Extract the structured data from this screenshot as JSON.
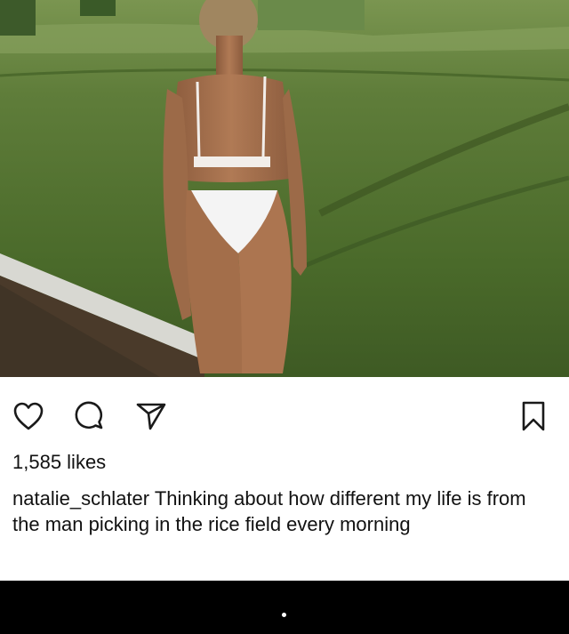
{
  "post": {
    "likes_text": "1,585 likes",
    "username": "natalie_schlater",
    "caption": "Thinking about how different my life is from the man picking in the rice field every morning"
  },
  "icons": {
    "like": "heart-icon",
    "comment": "comment-icon",
    "share": "send-icon",
    "save": "bookmark-icon"
  },
  "colors": {
    "icon_stroke": "#1a1a1a",
    "text": "#111111",
    "background": "#ffffff",
    "bottom_bar": "#000000"
  }
}
